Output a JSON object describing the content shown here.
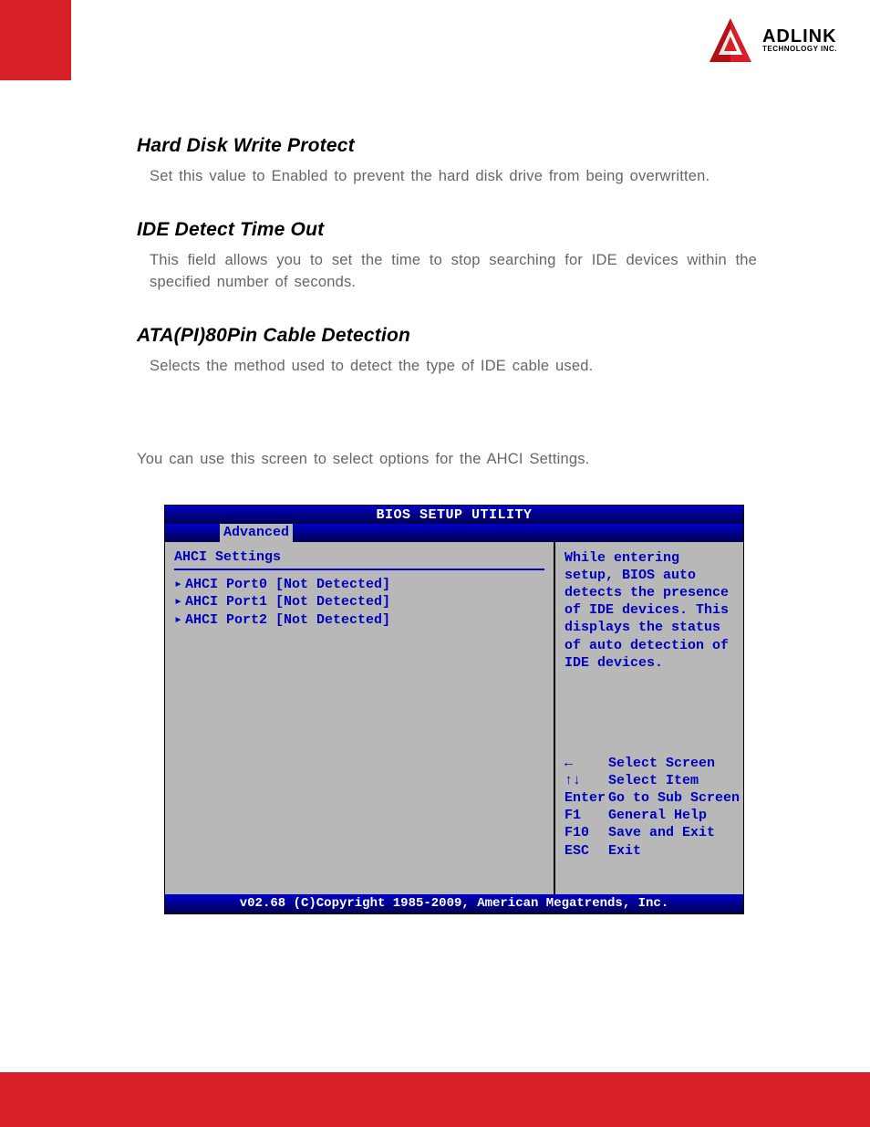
{
  "logo": {
    "brand": "ADLINK",
    "sub": "TECHNOLOGY INC.",
    "reg": "®"
  },
  "sections": [
    {
      "head": "Hard Disk Write Protect",
      "body": "Set this value to Enabled to prevent the hard disk drive from being overwritten."
    },
    {
      "head": "IDE Detect Time Out",
      "body": "This field allows you to set the time to stop searching for IDE devices within the specified number of seconds."
    },
    {
      "head": "ATA(PI)80Pin Cable Detection",
      "body": "Selects the method used to detect the type of IDE cable used."
    }
  ],
  "intro": "You can use this screen to select options for the AHCI Settings.",
  "bios": {
    "title": "BIOS SETUP UTILITY",
    "tab": "Advanced",
    "left_title": "AHCI Settings",
    "items": [
      "AHCI Port0 [Not Detected]",
      "AHCI Port1 [Not Detected]",
      "AHCI Port2 [Not Detected]"
    ],
    "help": "While entering setup, BIOS auto detects the presence of IDE devices. This displays the status of auto detection of IDE devices.",
    "keys": [
      {
        "key": "←",
        "label": "Select Screen"
      },
      {
        "key": "↑↓",
        "label": "Select Item"
      },
      {
        "key": "Enter",
        "label": "Go to Sub Screen"
      },
      {
        "key": "F1",
        "label": "General Help"
      },
      {
        "key": "F10",
        "label": "Save and Exit"
      },
      {
        "key": "ESC",
        "label": "Exit"
      }
    ],
    "footer": "v02.68 (C)Copyright 1985-2009, American Megatrends, Inc."
  }
}
